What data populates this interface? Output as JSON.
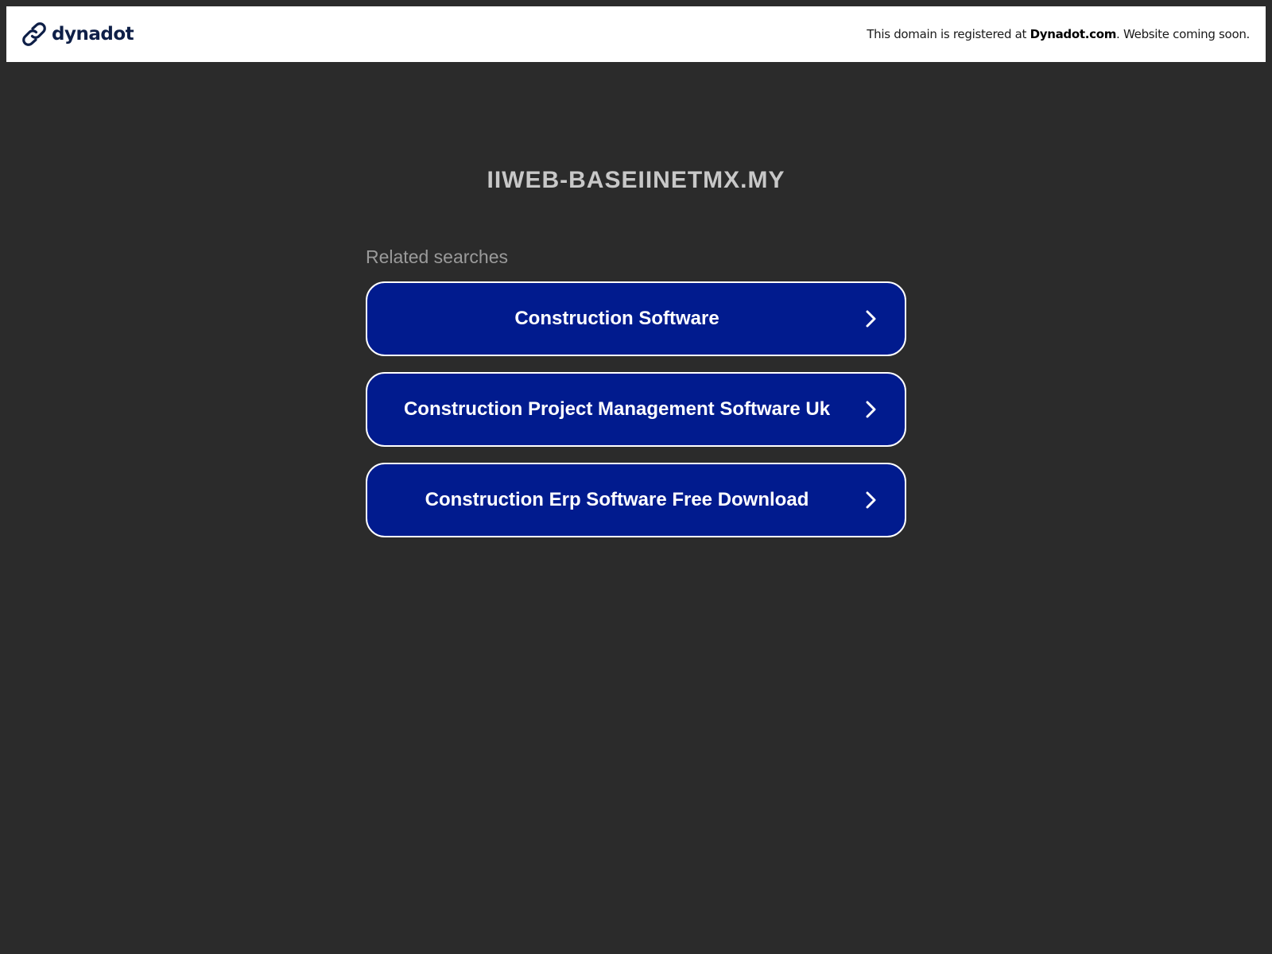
{
  "topbar": {
    "brand_name": "dynadot",
    "notice_prefix": "This domain is registered at ",
    "notice_link": "Dynadot.com",
    "notice_suffix": ". Website coming soon."
  },
  "main": {
    "domain_title": "IIWEB-BASEIINETMX.MY",
    "related_label": "Related searches",
    "searches": [
      {
        "label": "Construction Software"
      },
      {
        "label": "Construction Project Management Software Uk"
      },
      {
        "label": "Construction Erp Software Free Download"
      }
    ]
  },
  "icons": {
    "brand": "dynadot-logo-icon",
    "arrow": "chevron-right-icon"
  },
  "colors": {
    "page_background": "#2b2b2b",
    "topbar_background": "#ffffff",
    "brand": "#0e1f47",
    "button_background": "#011b8e",
    "button_border": "#ffffff",
    "title_text": "#c8c8c8",
    "related_label_text": "#9a9a9a"
  }
}
